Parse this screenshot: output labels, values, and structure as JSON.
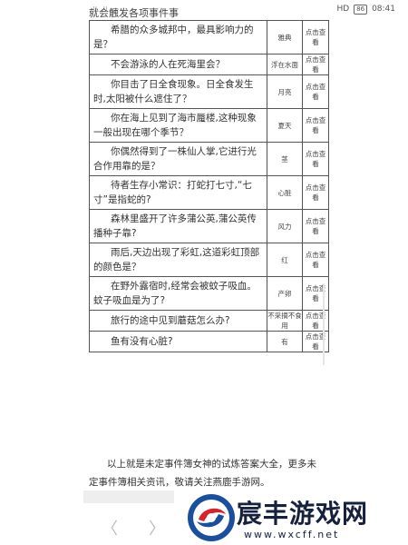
{
  "status_bar": {
    "signal_text": "ᵢˡˡ ᵢˡˡ ᯤ",
    "hd_label": "HD",
    "battery": "86",
    "time": "08:41"
  },
  "clipped_text": "就会触发各项事件事",
  "table": {
    "rows": [
      {
        "question": "希腊的众多城邦中，最具影响力的是？",
        "answer": "雅典",
        "action": "点击查看"
      },
      {
        "question": "不会游泳的人在死海里会？",
        "answer": "浮在水面",
        "action": "点击查看"
      },
      {
        "question": "你目击了日全食现象。日全食发生时,太阳被什么遮住了？",
        "answer": "月亮",
        "action": "点击查看"
      },
      {
        "question": "你在海上见到了海市蜃楼,这种现象一般出现在哪个季节？",
        "answer": "夏天",
        "action": "点击查看"
      },
      {
        "question": "你偶然得到了一株仙人掌,它进行光合作用靠的是？",
        "answer": "茎",
        "action": "点击查看"
      },
      {
        "question": "待者生存小常识：打蛇打七寸,“七寸”是指蛇的?",
        "answer": "心脏",
        "action": "点击查看"
      },
      {
        "question": "森林里盛开了许多蒲公英,蒲公英传播种子靠?",
        "answer": "风力",
        "action": "点击查看"
      },
      {
        "question": "雨后,天边出现了彩虹,这道彩虹顶部的颜色是？",
        "answer": "红",
        "action": "点击查看"
      },
      {
        "question": "在野外露宿时,经常会被蚊子吸血。蚊子吸血是为了?",
        "answer": "产卵",
        "action": "点击查看"
      },
      {
        "question": "旅行的途中见到蘑菇怎么办?",
        "answer": "不采摘不食用",
        "action": "点击查看"
      },
      {
        "question": "鱼有没有心脏?",
        "answer": "有",
        "action": "点击查看"
      }
    ]
  },
  "footer_text": "以上就是未定事件簿女神的试炼答案大全，更多未定事件簿相关资讯，敬请关注燕鹿手游网。",
  "nav": {
    "back_glyph": "〈",
    "forward_glyph": "〉"
  },
  "watermark": {
    "brand": "宸丰游戏网",
    "url": "www.wxcff.net"
  },
  "colors": {
    "logo_blue": "#1a4fa0",
    "logo_red": "#d8232a",
    "logo_text": "#16213e"
  }
}
